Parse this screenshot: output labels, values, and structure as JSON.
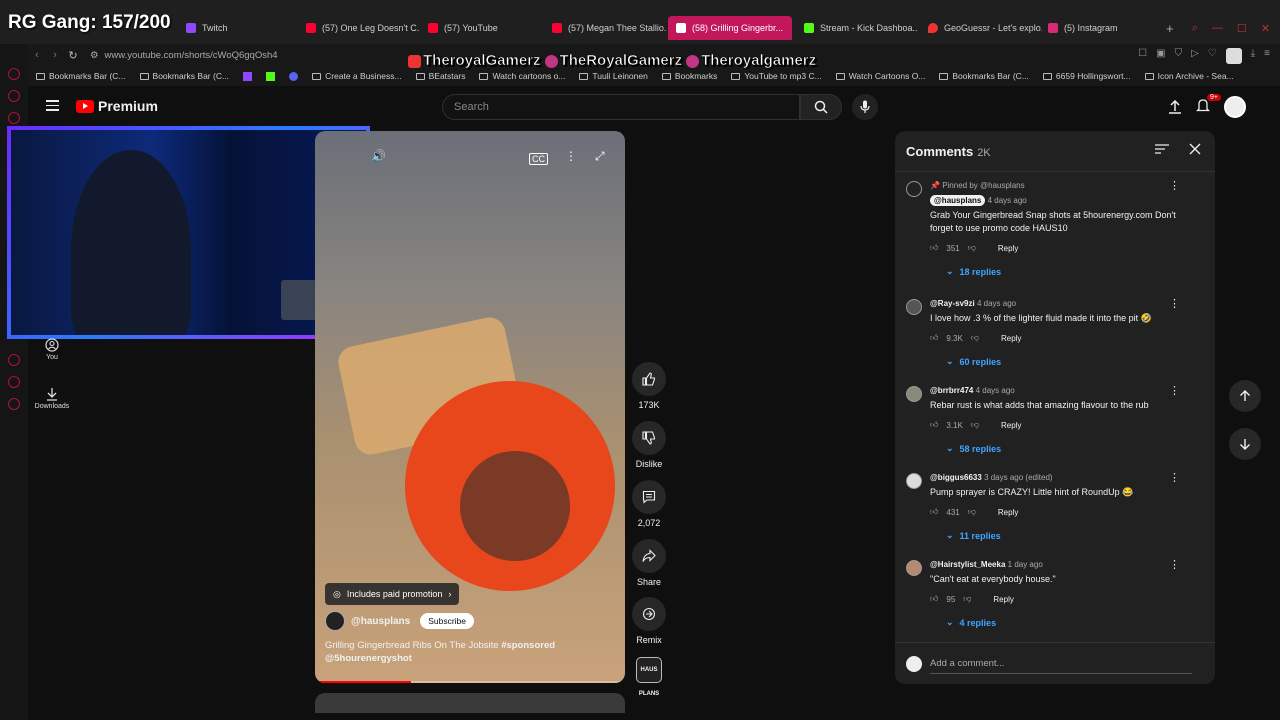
{
  "overlay": {
    "title": "RG Gang: 157/200",
    "socials": [
      "TheroyalGamerz",
      "TheRoyalGamerz",
      "Theroyalgamerz"
    ]
  },
  "tabs": [
    {
      "label": "Twitch",
      "color": "#9146ff"
    },
    {
      "label": "(57) One Leg Doesn't C...",
      "color": "#ff0033"
    },
    {
      "label": "(57) YouTube",
      "color": "#ff0033"
    },
    {
      "label": "(57) Megan Thee Stallio...",
      "color": "#ff0033"
    },
    {
      "label": "(58) Grilling Gingerbr...",
      "color": "#ff0033"
    },
    {
      "label": "Stream - Kick Dashboa...",
      "color": "#53fc18"
    },
    {
      "label": "GeoGuessr - Let's explo...",
      "color": "#e33"
    },
    {
      "label": "(5) Instagram",
      "color": "#d62976"
    }
  ],
  "address": {
    "url": "www.youtube.com/shorts/cWoQ6gqOsh4"
  },
  "bookmarks": [
    "Bookmarks Bar (C...",
    "Bookmarks Bar (C...",
    "Create a Business...",
    "BEatstars",
    "Watch cartoons o...",
    "Tuuli Leinonen",
    "Bookmarks",
    "YouTube to mp3 C...",
    "Watch Cartoons O...",
    "Bookmarks Bar (C...",
    "6659 Hollingswort...",
    "Icon Archive - Sea..."
  ],
  "masthead": {
    "logo": "Premium",
    "search_placeholder": "Search",
    "notif_count": "9+"
  },
  "sidebar": {
    "you": "You",
    "downloads": "Downloads"
  },
  "video": {
    "promo": "Includes paid promotion",
    "channel": "@hausplans",
    "subscribe": "Subscribe",
    "title": "Grilling Gingerbread Ribs On The Jobsite",
    "title_tags": "#sponsored",
    "title_line2": "@5hourenergyshot",
    "progress": 0.31
  },
  "actions": {
    "likes": "173K",
    "dislike": "Dislike",
    "comments": "2,072",
    "share": "Share",
    "remix": "Remix",
    "channel_thumb": "HAUS PLANS"
  },
  "comments": {
    "heading": "Comments",
    "count": "2K",
    "add_placeholder": "Add a comment...",
    "items": [
      {
        "pinned": "Pinned by @hausplans",
        "handle": "@hausplans",
        "time": "4 days ago",
        "text": "Grab Your Gingerbread Snap shots at 5hourenergy.com Don't forget to use promo code HAUS10",
        "likes": "351",
        "reply": "Reply",
        "replies": "18 replies"
      },
      {
        "handle": "@Ray-sv9zi",
        "time": "4 days ago",
        "text": "I love how .3 % of the lighter fluid made it into the pit 🤣",
        "likes": "9.3K",
        "reply": "Reply",
        "replies": "60 replies"
      },
      {
        "handle": "@brrbrr474",
        "time": "4 days ago",
        "text": "Rebar rust is what adds that amazing flavour to the rub",
        "likes": "3.1K",
        "reply": "Reply",
        "replies": "58 replies"
      },
      {
        "handle": "@biggus6633",
        "time": "3 days ago (edited)",
        "text": "Pump sprayer is CRAZY! Little hint of RoundUp 😂",
        "likes": "431",
        "reply": "Reply",
        "replies": "11 replies"
      },
      {
        "handle": "@Hairstylist_Meeka",
        "time": "1 day ago",
        "text": "\"Can't eat at everybody house.\"",
        "likes": "95",
        "reply": "Reply",
        "replies": "4 replies"
      }
    ]
  }
}
